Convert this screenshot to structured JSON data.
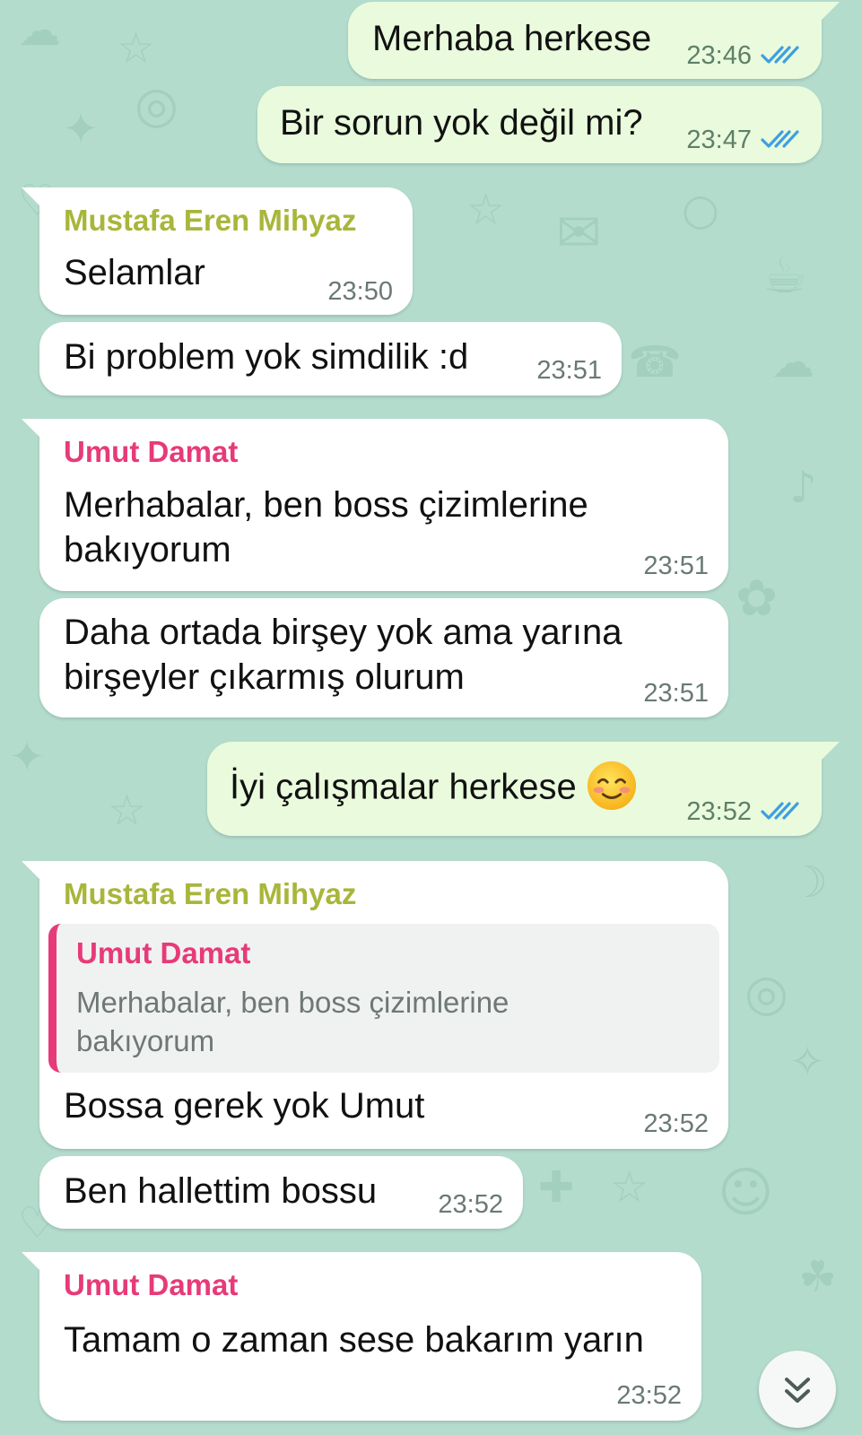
{
  "colors": {
    "background": "#b3dccd",
    "incoming_bubble": "#ffffff",
    "outgoing_bubble": "#e9fbdc",
    "read_ticks": "#3d9fe0",
    "sender_mustafa": "#a8b63a",
    "sender_umut": "#e73a78"
  },
  "messages": [
    {
      "id": "m1",
      "direction": "outgoing",
      "text": "Merhaba herkese",
      "time": "23:46",
      "status": "read"
    },
    {
      "id": "m2",
      "direction": "outgoing",
      "text": "Bir sorun yok değil mi?",
      "time": "23:47",
      "status": "read"
    },
    {
      "id": "m3",
      "direction": "incoming",
      "sender": "Mustafa Eren Mihyaz",
      "text": "Selamlar",
      "time": "23:50"
    },
    {
      "id": "m4",
      "direction": "incoming",
      "text": "Bi problem yok simdilik :d",
      "time": "23:51"
    },
    {
      "id": "m5",
      "direction": "incoming",
      "sender": "Umut Damat",
      "lines": [
        "Merhabalar, ben boss çizimlerine",
        "bakıyorum"
      ],
      "time": "23:51"
    },
    {
      "id": "m6",
      "direction": "incoming",
      "lines": [
        "Daha ortada birşey yok ama yarına",
        "birşeyler çıkarmış olurum"
      ],
      "time": "23:51"
    },
    {
      "id": "m7",
      "direction": "outgoing",
      "text": "İyi çalışmalar herkese",
      "emoji": "smiling-face-icon",
      "time": "23:52",
      "status": "read"
    },
    {
      "id": "m8",
      "direction": "incoming",
      "sender": "Mustafa Eren Mihyaz",
      "quote": {
        "sender": "Umut Damat",
        "lines": [
          "Merhabalar, ben boss çizimlerine",
          "bakıyorum"
        ]
      },
      "text": "Bossa gerek yok Umut",
      "time": "23:52"
    },
    {
      "id": "m9",
      "direction": "incoming",
      "text": "Ben hallettim bossu",
      "time": "23:52"
    },
    {
      "id": "m10",
      "direction": "incoming",
      "sender": "Umut Damat",
      "text": "Tamam o zaman sese bakarım yarın",
      "time": "23:52"
    }
  ],
  "scroll_button": {
    "icon": "double-chevron-down-icon"
  }
}
